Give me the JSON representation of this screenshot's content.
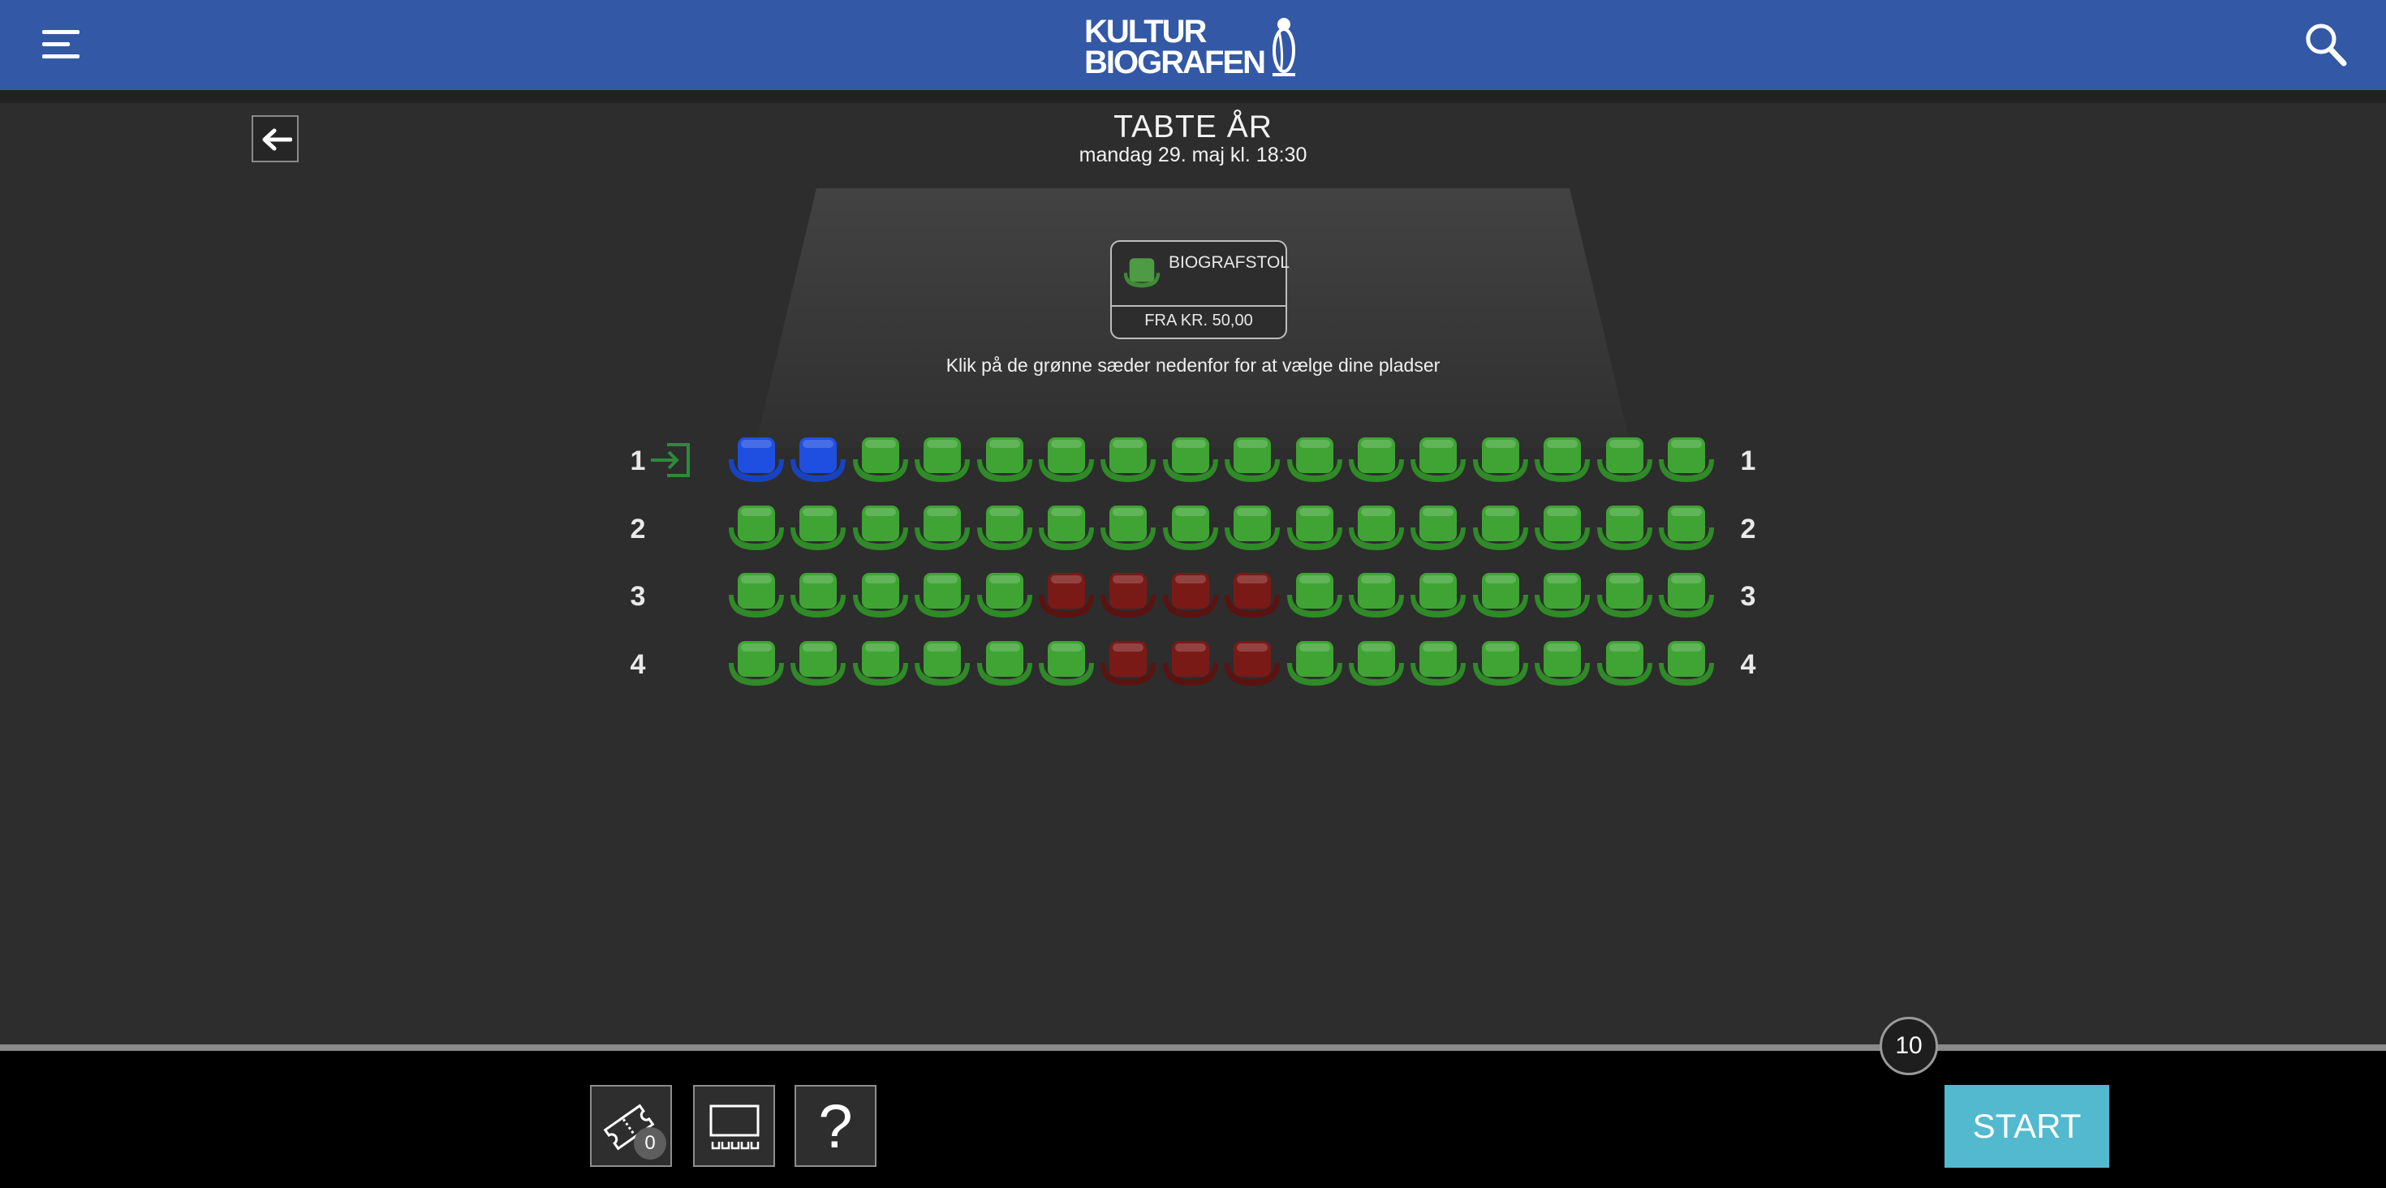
{
  "header": {
    "logo_line1": "KULTUR",
    "logo_line2": "BIOGRAFEN",
    "menu_icon": "hamburger-menu-icon",
    "search_icon": "search-icon",
    "color": "#3358a6"
  },
  "show": {
    "title": "TABTE ÅR",
    "datetime": "mandag 29. maj kl. 18:30"
  },
  "legend": {
    "seat_type": "BIOGRAFSTOL",
    "price": "FRA KR. 50,00"
  },
  "instruction": "Klik på de grønne sæder nedenfor for at vælge dine pladser",
  "seat_colors": {
    "available": "#3fa434",
    "selected": "#1f4fe0",
    "sold": "#7a1a17"
  },
  "seatmap": {
    "rows": [
      {
        "label": "1",
        "entrance": true,
        "seats": [
          "selected",
          "selected",
          "available",
          "available",
          "available",
          "available",
          "available",
          "available",
          "available",
          "available",
          "available",
          "available",
          "available",
          "available",
          "available",
          "available"
        ]
      },
      {
        "label": "2",
        "entrance": false,
        "seats": [
          "available",
          "available",
          "available",
          "available",
          "available",
          "available",
          "available",
          "available",
          "available",
          "available",
          "available",
          "available",
          "available",
          "available",
          "available",
          "available"
        ]
      },
      {
        "label": "3",
        "entrance": false,
        "seats": [
          "available",
          "available",
          "available",
          "available",
          "available",
          "sold",
          "sold",
          "sold",
          "sold",
          "available",
          "available",
          "available",
          "available",
          "available",
          "available",
          "available"
        ]
      },
      {
        "label": "4",
        "entrance": false,
        "seats": [
          "available",
          "available",
          "available",
          "available",
          "available",
          "available",
          "sold",
          "sold",
          "sold",
          "available",
          "available",
          "available",
          "available",
          "available",
          "available",
          "available"
        ]
      }
    ]
  },
  "timer": "10",
  "footer": {
    "ticket_count": "0",
    "help_label": "?",
    "start_label": "START",
    "start_color": "#52b9cf"
  }
}
